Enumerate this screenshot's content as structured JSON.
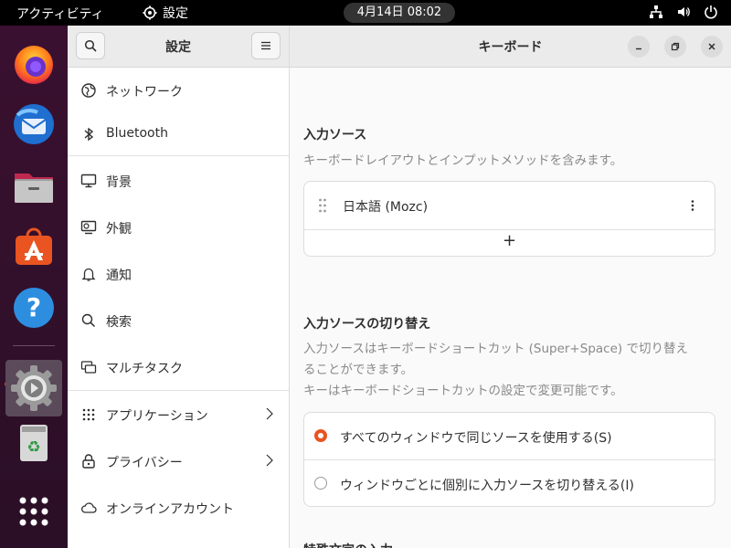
{
  "topbar": {
    "activities": "アクティビティ",
    "app_menu": "設定",
    "clock": "4月14日  08:02"
  },
  "sidebar": {
    "title": "設定",
    "items": [
      {
        "label": "ネットワーク",
        "icon": "network-icon"
      },
      {
        "label": "Bluetooth",
        "icon": "bluetooth-icon"
      },
      {
        "label": "背景",
        "icon": "display-icon"
      },
      {
        "label": "外観",
        "icon": "appearance-icon"
      },
      {
        "label": "通知",
        "icon": "bell-icon"
      },
      {
        "label": "検索",
        "icon": "search-icon"
      },
      {
        "label": "マルチタスク",
        "icon": "multitask-icon"
      },
      {
        "label": "アプリケーション",
        "icon": "apps-grid-icon"
      },
      {
        "label": "プライバシー",
        "icon": "lock-icon"
      },
      {
        "label": "オンラインアカウント",
        "icon": "cloud-icon"
      }
    ]
  },
  "content": {
    "title": "キーボード",
    "input_sources": {
      "title": "入力ソース",
      "description": "キーボードレイアウトとインプットメソッドを含みます。",
      "source": "日本語 (Mozc)",
      "add_label": "+"
    },
    "switching": {
      "title": "入力ソースの切り替え",
      "description_1": "入力ソースはキーボードショートカット (Super+Space) で切り替え",
      "description_2": "ることができます。",
      "description_3": "キーはキーボードショートカットの設定で変更可能です。",
      "options": [
        {
          "label": "すべてのウィンドウで同じソースを使用する(S)",
          "selected": true
        },
        {
          "label": "ウィンドウごとに個別に入力ソースを切り替える(I)",
          "selected": false
        }
      ]
    },
    "special_chars": {
      "title": "特殊文字の入力"
    }
  },
  "colors": {
    "accent": "#e95420",
    "topbar": "#000000",
    "dock": "#2c001e"
  }
}
